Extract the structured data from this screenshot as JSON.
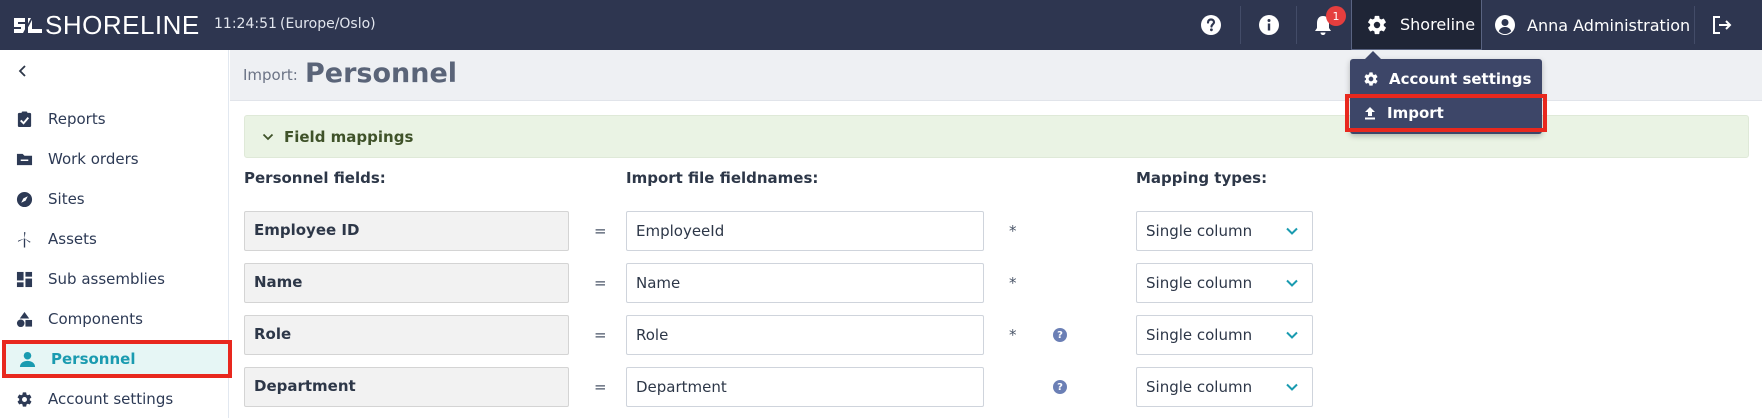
{
  "topbar": {
    "logo_text": "SHORELINE",
    "time": "11:24:51",
    "timezone": "(Europe/Oslo)",
    "notification_count": "1",
    "org_label": "Shoreline",
    "user_label": "Anna Administration"
  },
  "dropdown": {
    "items": [
      {
        "label": "Account settings",
        "icon": "gear-icon"
      },
      {
        "label": "Import",
        "icon": "upload-icon"
      }
    ]
  },
  "sidebar": {
    "items": [
      {
        "label": "Reports",
        "icon": "clipboard-check-icon"
      },
      {
        "label": "Work orders",
        "icon": "folder-icon"
      },
      {
        "label": "Sites",
        "icon": "compass-icon"
      },
      {
        "label": "Assets",
        "icon": "wind-turbine-icon"
      },
      {
        "label": "Sub assemblies",
        "icon": "dashboard-grid-icon"
      },
      {
        "label": "Components",
        "icon": "shapes-icon"
      },
      {
        "label": "Personnel",
        "icon": "person-icon",
        "active": true
      },
      {
        "label": "Account settings",
        "icon": "gear-icon"
      }
    ]
  },
  "page": {
    "breadcrumb": "Import:",
    "title": "Personnel"
  },
  "section": {
    "title": "Field mappings"
  },
  "columns": {
    "personnel_fields": "Personnel fields:",
    "import_fieldnames": "Import file fieldnames:",
    "mapping_types": "Mapping types:"
  },
  "rows": [
    {
      "field": "Employee ID",
      "equals": "=",
      "value": "EmployeeId",
      "required": "*",
      "help": false,
      "mapping": "Single column"
    },
    {
      "field": "Name",
      "equals": "=",
      "value": "Name",
      "required": "*",
      "help": false,
      "mapping": "Single column"
    },
    {
      "field": "Role",
      "equals": "=",
      "value": "Role",
      "required": "*",
      "help": true,
      "mapping": "Single column"
    },
    {
      "field": "Department",
      "equals": "=",
      "value": "Department",
      "required": "",
      "help": true,
      "mapping": "Single column"
    }
  ],
  "help_glyph": "?",
  "colors": {
    "topbar": "#2e3650",
    "accent": "#1a9bb0",
    "highlight": "#e8281e",
    "badge": "#e53e3e"
  }
}
